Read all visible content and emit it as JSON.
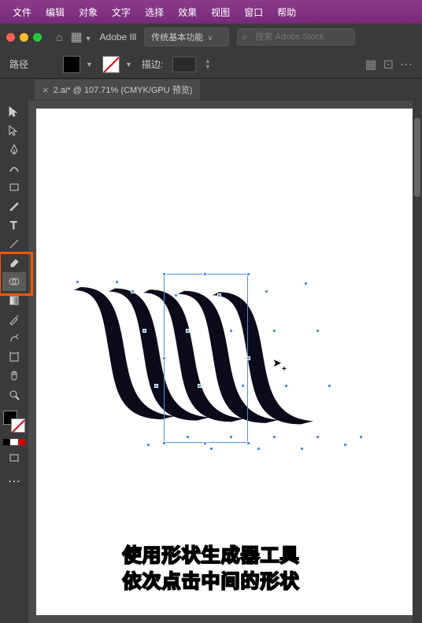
{
  "menubar": {
    "items": [
      "文件",
      "编辑",
      "对象",
      "文字",
      "选择",
      "效果",
      "视图",
      "窗口",
      "帮助"
    ]
  },
  "topbar": {
    "app_name": "Adobe Ill",
    "workspace": "传统基本功能",
    "search_placeholder": "搜索 Adobe Stock"
  },
  "options": {
    "path_label": "路径",
    "stroke_label": "描边:",
    "stroke_value": ""
  },
  "document": {
    "tab_title": "2.ai* @ 107.71% (CMYK/GPU 预览)"
  },
  "caption": {
    "line1": "使用形状生成器工具",
    "line2": "依次点击中间的形状"
  },
  "colors": {
    "menubar_bg": "#7a2a7a",
    "panel_bg": "#3a3a3a",
    "highlight": "#ff5500",
    "anchor": "#4a90e2",
    "caption_fill": "#ffd700"
  }
}
